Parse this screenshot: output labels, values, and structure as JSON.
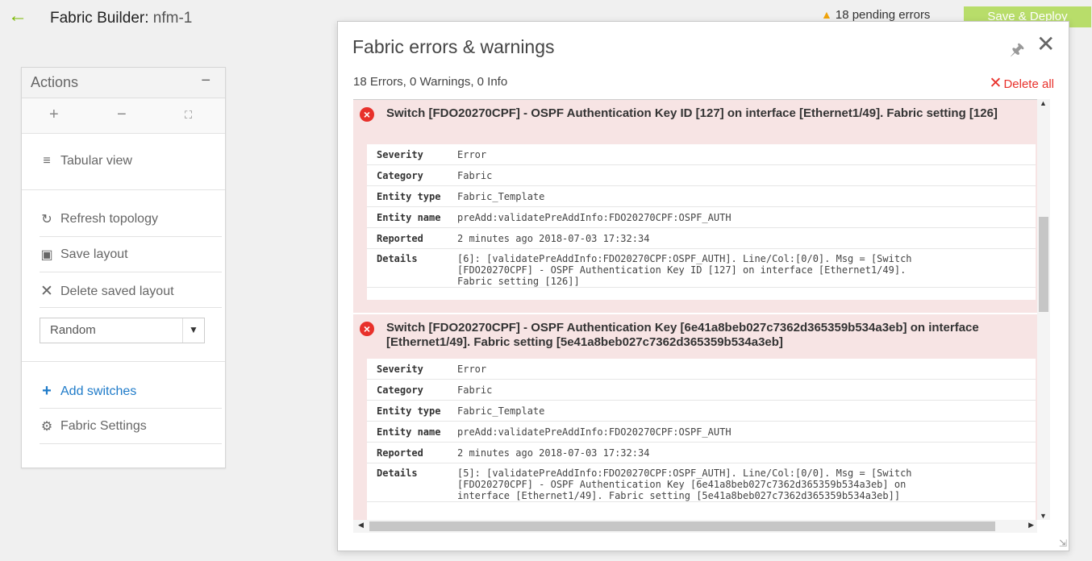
{
  "header": {
    "title": "Fabric Builder:",
    "fabric_name": "nfm-1",
    "pending": "18 pending errors",
    "deploy_label": "Save & Deploy",
    "accent_color": "#7ab800"
  },
  "actions": {
    "title": "Actions",
    "collapse": "−",
    "zoom_in": "+",
    "zoom_out": "−",
    "items": {
      "tabular": "Tabular view",
      "refresh": "Refresh topology",
      "save_layout": "Save layout",
      "delete_layout": "Delete saved layout",
      "add_switches": "Add switches",
      "fabric_settings": "Fabric Settings"
    },
    "layout_select": "Random"
  },
  "modal": {
    "title": "Fabric errors & warnings",
    "summary": "18 Errors, 0 Warnings, 0 Info",
    "delete_all": "Delete all",
    "labels": {
      "severity": "Severity",
      "category": "Category",
      "entity_type": "Entity type",
      "entity_name": "Entity name",
      "reported": "Reported",
      "details": "Details"
    },
    "errors": [
      {
        "title": "Switch [FDO20270CPF] - OSPF Authentication Key ID [127] on interface [Ethernet1/49]. Fabric setting [126]",
        "severity": "Error",
        "category": "Fabric",
        "entity_type": "Fabric_Template",
        "entity_name": "preAdd:validatePreAddInfo:FDO20270CPF:OSPF_AUTH",
        "reported": "2 minutes ago 2018-07-03 17:32:34",
        "details_1": "[6]: [validatePreAddInfo:FDO20270CPF:OSPF_AUTH]. Line/Col:[0/0]. Msg = [Switch",
        "details_2": "[FDO20270CPF] - OSPF Authentication Key ID [127] on interface [Ethernet1/49].",
        "details_3": "Fabric setting [126]]"
      },
      {
        "title": "Switch [FDO20270CPF] - OSPF Authentication Key [6e41a8beb027c7362d365359b534a3eb] on interface [Ethernet1/49]. Fabric setting [5e41a8beb027c7362d365359b534a3eb]",
        "severity": "Error",
        "category": "Fabric",
        "entity_type": "Fabric_Template",
        "entity_name": "preAdd:validatePreAddInfo:FDO20270CPF:OSPF_AUTH",
        "reported": "2 minutes ago 2018-07-03 17:32:34",
        "details_1": "[5]: [validatePreAddInfo:FDO20270CPF:OSPF_AUTH]. Line/Col:[0/0]. Msg = [Switch",
        "details_2": "[FDO20270CPF] - OSPF Authentication Key [6e41a8beb027c7362d365359b534a3eb] on",
        "details_3": "interface [Ethernet1/49]. Fabric setting [5e41a8beb027c7362d365359b534a3eb]]"
      }
    ]
  }
}
